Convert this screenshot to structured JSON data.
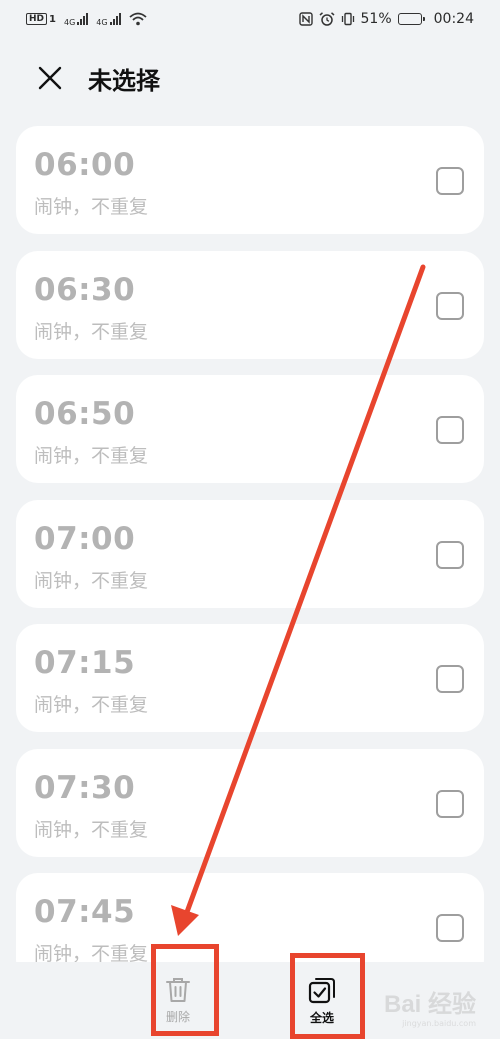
{
  "status_bar": {
    "hd_badge": "HD",
    "sim1": "1",
    "net1": "4G",
    "net2": "4G",
    "battery_percent": "51%",
    "time": "00:24",
    "battery_level": 0.51
  },
  "header": {
    "title": "未选择",
    "close_icon": "close-icon"
  },
  "alarms": [
    {
      "time": "06:00",
      "subtitle": "闹钟，不重复"
    },
    {
      "time": "06:30",
      "subtitle": "闹钟，不重复"
    },
    {
      "time": "06:50",
      "subtitle": "闹钟，不重复"
    },
    {
      "time": "07:00",
      "subtitle": "闹钟，不重复"
    },
    {
      "time": "07:15",
      "subtitle": "闹钟，不重复"
    },
    {
      "time": "07:30",
      "subtitle": "闹钟，不重复"
    },
    {
      "time": "07:45",
      "subtitle": "闹钟，不重复"
    }
  ],
  "bottom_bar": {
    "delete_label": "删除",
    "select_all_label": "全选",
    "delete_icon": "trash-icon",
    "select_all_icon": "select-all-icon"
  },
  "annotation": {
    "accent_color": "#e8452e"
  },
  "watermark": {
    "main": "Bai 经验",
    "sub": "jingyan.baidu.com"
  }
}
